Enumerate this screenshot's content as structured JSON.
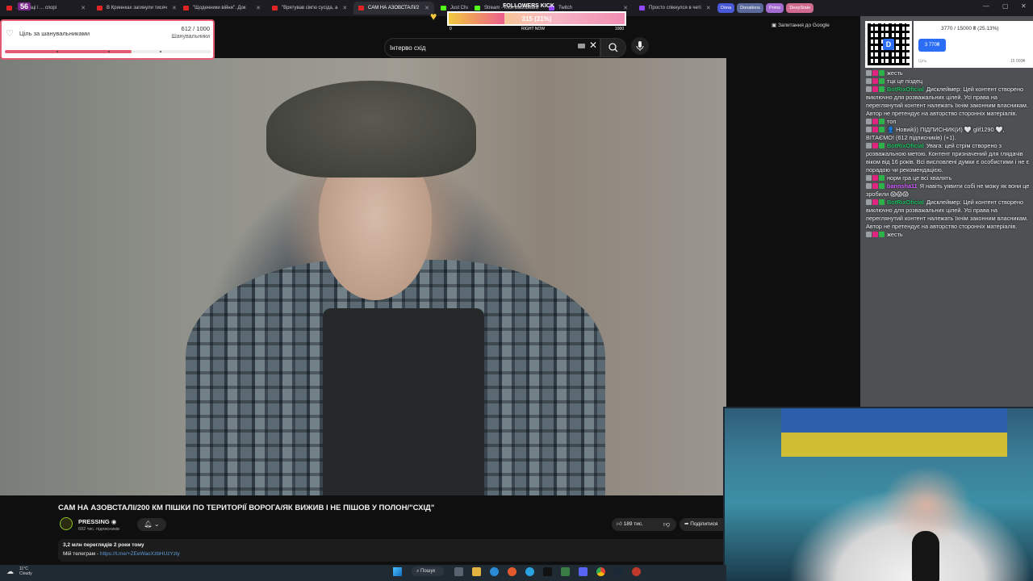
{
  "browser": {
    "tabs": [
      {
        "label": "...гентаці і ... спорі",
        "fav": "#e02424"
      },
      {
        "label": "В Криннках загинули тисяч",
        "fav": "#e02424"
      },
      {
        "label": "\"Щоденники війни\". Док",
        "fav": "#e02424"
      },
      {
        "label": "\"Врятував сім'ю сусіда, а",
        "fav": "#e02424"
      },
      {
        "label": "САМ НА АЗОВСТАЛІ/2",
        "fav": "#e02424",
        "active": true
      },
      {
        "label": "Just Chatting",
        "fav": "#53fc18"
      },
      {
        "label": "Stream - Kick Dashboard",
        "fav": "#53fc18"
      },
      {
        "label": "Twitch",
        "fav": "#9146ff"
      },
      {
        "label": "Просто спікнулся в четі",
        "fav": "#9146ff"
      }
    ],
    "pills": [
      {
        "label": "Dona",
        "color": "#4a5ad6"
      },
      {
        "label": "Donations",
        "color": "#5b6a9a"
      },
      {
        "label": "Prime",
        "color": "#a36ad0"
      },
      {
        "label": "DeepState",
        "color": "#d06a8f"
      }
    ],
    "overlay_counter": "56"
  },
  "youtube": {
    "search_value": "Інтерво схід",
    "ask_google": "Запитання до Google",
    "video_title": "САМ НА АЗОВСТАЛІ/200 КМ ПІШКИ ПО ТЕРИТОРІЇ ВОРОГА/ЯК ВИЖИВ І НЕ ПІШОВ У ПОЛОН/\"СХІД\"",
    "channel": "PRESSING",
    "subs": "692 тис. підписників",
    "likes": "189 тис.",
    "share": "Поділитися",
    "views_date": "3,2 млн переглядів  2 роки тому",
    "desc_prefix": "Мій телеграм - ",
    "desc_link": "https://t.me/+ZEeWaoXzbHUzYzly"
  },
  "goal_widget": {
    "label": "Ціль за шанувальниками",
    "count": "612 / 1000",
    "unit": "Шанувальники",
    "progress": 0.612,
    "color": "#e25a73"
  },
  "kick_goal": {
    "title": "FOLLOWERS KICK",
    "value": "315 (31%)",
    "progress": 0.315,
    "min": "0",
    "mid": "RIGHT NOW",
    "max": "1000"
  },
  "donation": {
    "text": "3770 / 15000 ₴ (25.13%)",
    "pill": "3 770₴",
    "min": "Ціль",
    "max": "15 000₴",
    "accent": "#2b6ef5"
  },
  "chat": [
    {
      "user": "",
      "ucolor": "#5aa9ff",
      "text": "жесть"
    },
    {
      "user": "",
      "ucolor": "#5aa9ff",
      "text": "тцк це піздец"
    },
    {
      "user": "BotRixOficial",
      "ucolor": "#1fbf5f",
      "text": "Дисклеймер: Цей контент створено виключно для розважальних цілей. Усі права на переглянутий контент належать їхнім законним власникам. Автор не претендує на авторство сторонніх матеріалів."
    },
    {
      "user": "",
      "ucolor": "#5aa9ff",
      "text": "топ"
    },
    {
      "user": "",
      "ucolor": "#5aa9ff",
      "text": "👤 Новий(і) ПІДПИСНИК(И) 🤍 glif1290 🤍, ВІТАЄМО! (612 підписників) (+1)."
    },
    {
      "user": "BotRixOficial",
      "ucolor": "#1fbf5f",
      "text": "Увага: цей стрім створено з розважальною метою. Контент призначений для глядачів віком від 16 років. Всі висловлені думки є особистими і не є порадою чи рекомендацією."
    },
    {
      "user": "",
      "ucolor": "#5aa9ff",
      "text": "норм гра це всі хвалять"
    },
    {
      "user": "bannsha11",
      "ucolor": "#d15cff",
      "text": "Я навіть уявити собі не можу як вони це зробили 😱😱😱"
    },
    {
      "user": "BotRixOficial",
      "ucolor": "#1fbf5f",
      "text": "Дисклеймер: Цей контент створено виключно для розважальних цілей. Усі права на переглянутий контент належать їхнім законним власникам. Автор не претендує на авторство сторонніх матеріалів."
    },
    {
      "user": "",
      "ucolor": "#5aa9ff",
      "text": "жесть"
    }
  ],
  "taskbar": {
    "weather_temp": "11°C",
    "weather_desc": "Cloudy",
    "search_label": "Пошук"
  }
}
